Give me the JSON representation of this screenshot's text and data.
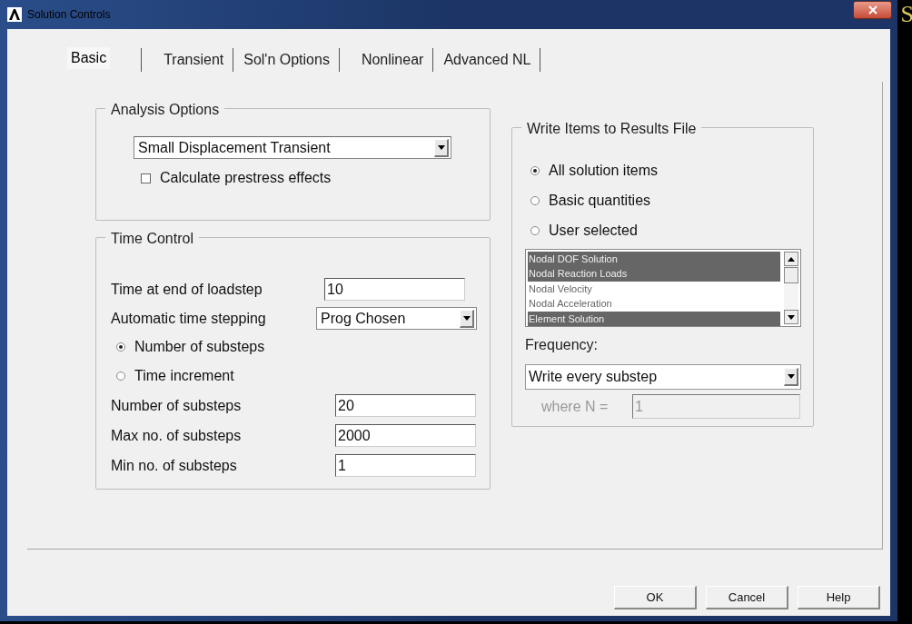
{
  "window": {
    "title": "Solution Controls"
  },
  "background_text": "S",
  "tabs": [
    {
      "label": "Basic",
      "selected": true
    },
    {
      "label": "Transient",
      "selected": false
    },
    {
      "label": "Sol'n Options",
      "selected": false
    },
    {
      "label": "Nonlinear",
      "selected": false
    },
    {
      "label": "Advanced NL",
      "selected": false
    }
  ],
  "analysis_options": {
    "title": "Analysis Options",
    "analysis_type": "Small Displacement Transient",
    "prestress": {
      "label": "Calculate prestress effects",
      "checked": false
    }
  },
  "time_control": {
    "title": "Time Control",
    "rows": [
      {
        "kind": "field",
        "label": "Time at end of loadstep",
        "value": "10"
      },
      {
        "kind": "dropdown",
        "label": "Automatic time stepping",
        "value": "Prog Chosen"
      },
      {
        "kind": "radio",
        "label": "Number of substeps",
        "selected": true
      },
      {
        "kind": "radio",
        "label": "Time increment",
        "selected": false
      },
      {
        "kind": "field",
        "label": "Number of substeps",
        "value": "20"
      },
      {
        "kind": "field",
        "label": "Max no. of substeps",
        "value": "2000"
      },
      {
        "kind": "field",
        "label": "Min no. of substeps",
        "value": "1"
      }
    ]
  },
  "write_items": {
    "title": "Write Items to Results File",
    "options": [
      {
        "label": "All solution items",
        "selected": true
      },
      {
        "label": "Basic quantities",
        "selected": false
      },
      {
        "label": "User selected",
        "selected": false
      }
    ],
    "items": [
      {
        "label": "Nodal DOF Solution",
        "selected": true
      },
      {
        "label": "Nodal Reaction Loads",
        "selected": true
      },
      {
        "label": "Nodal Velocity",
        "selected": false
      },
      {
        "label": "Nodal Acceleration",
        "selected": false
      },
      {
        "label": "Element Solution",
        "selected": true
      }
    ],
    "frequency_label": "Frequency:",
    "frequency": "Write every substep",
    "n_label": "where N =",
    "n_value": "1",
    "n_disabled": true
  },
  "buttons": [
    "OK",
    "Cancel",
    "Help"
  ]
}
